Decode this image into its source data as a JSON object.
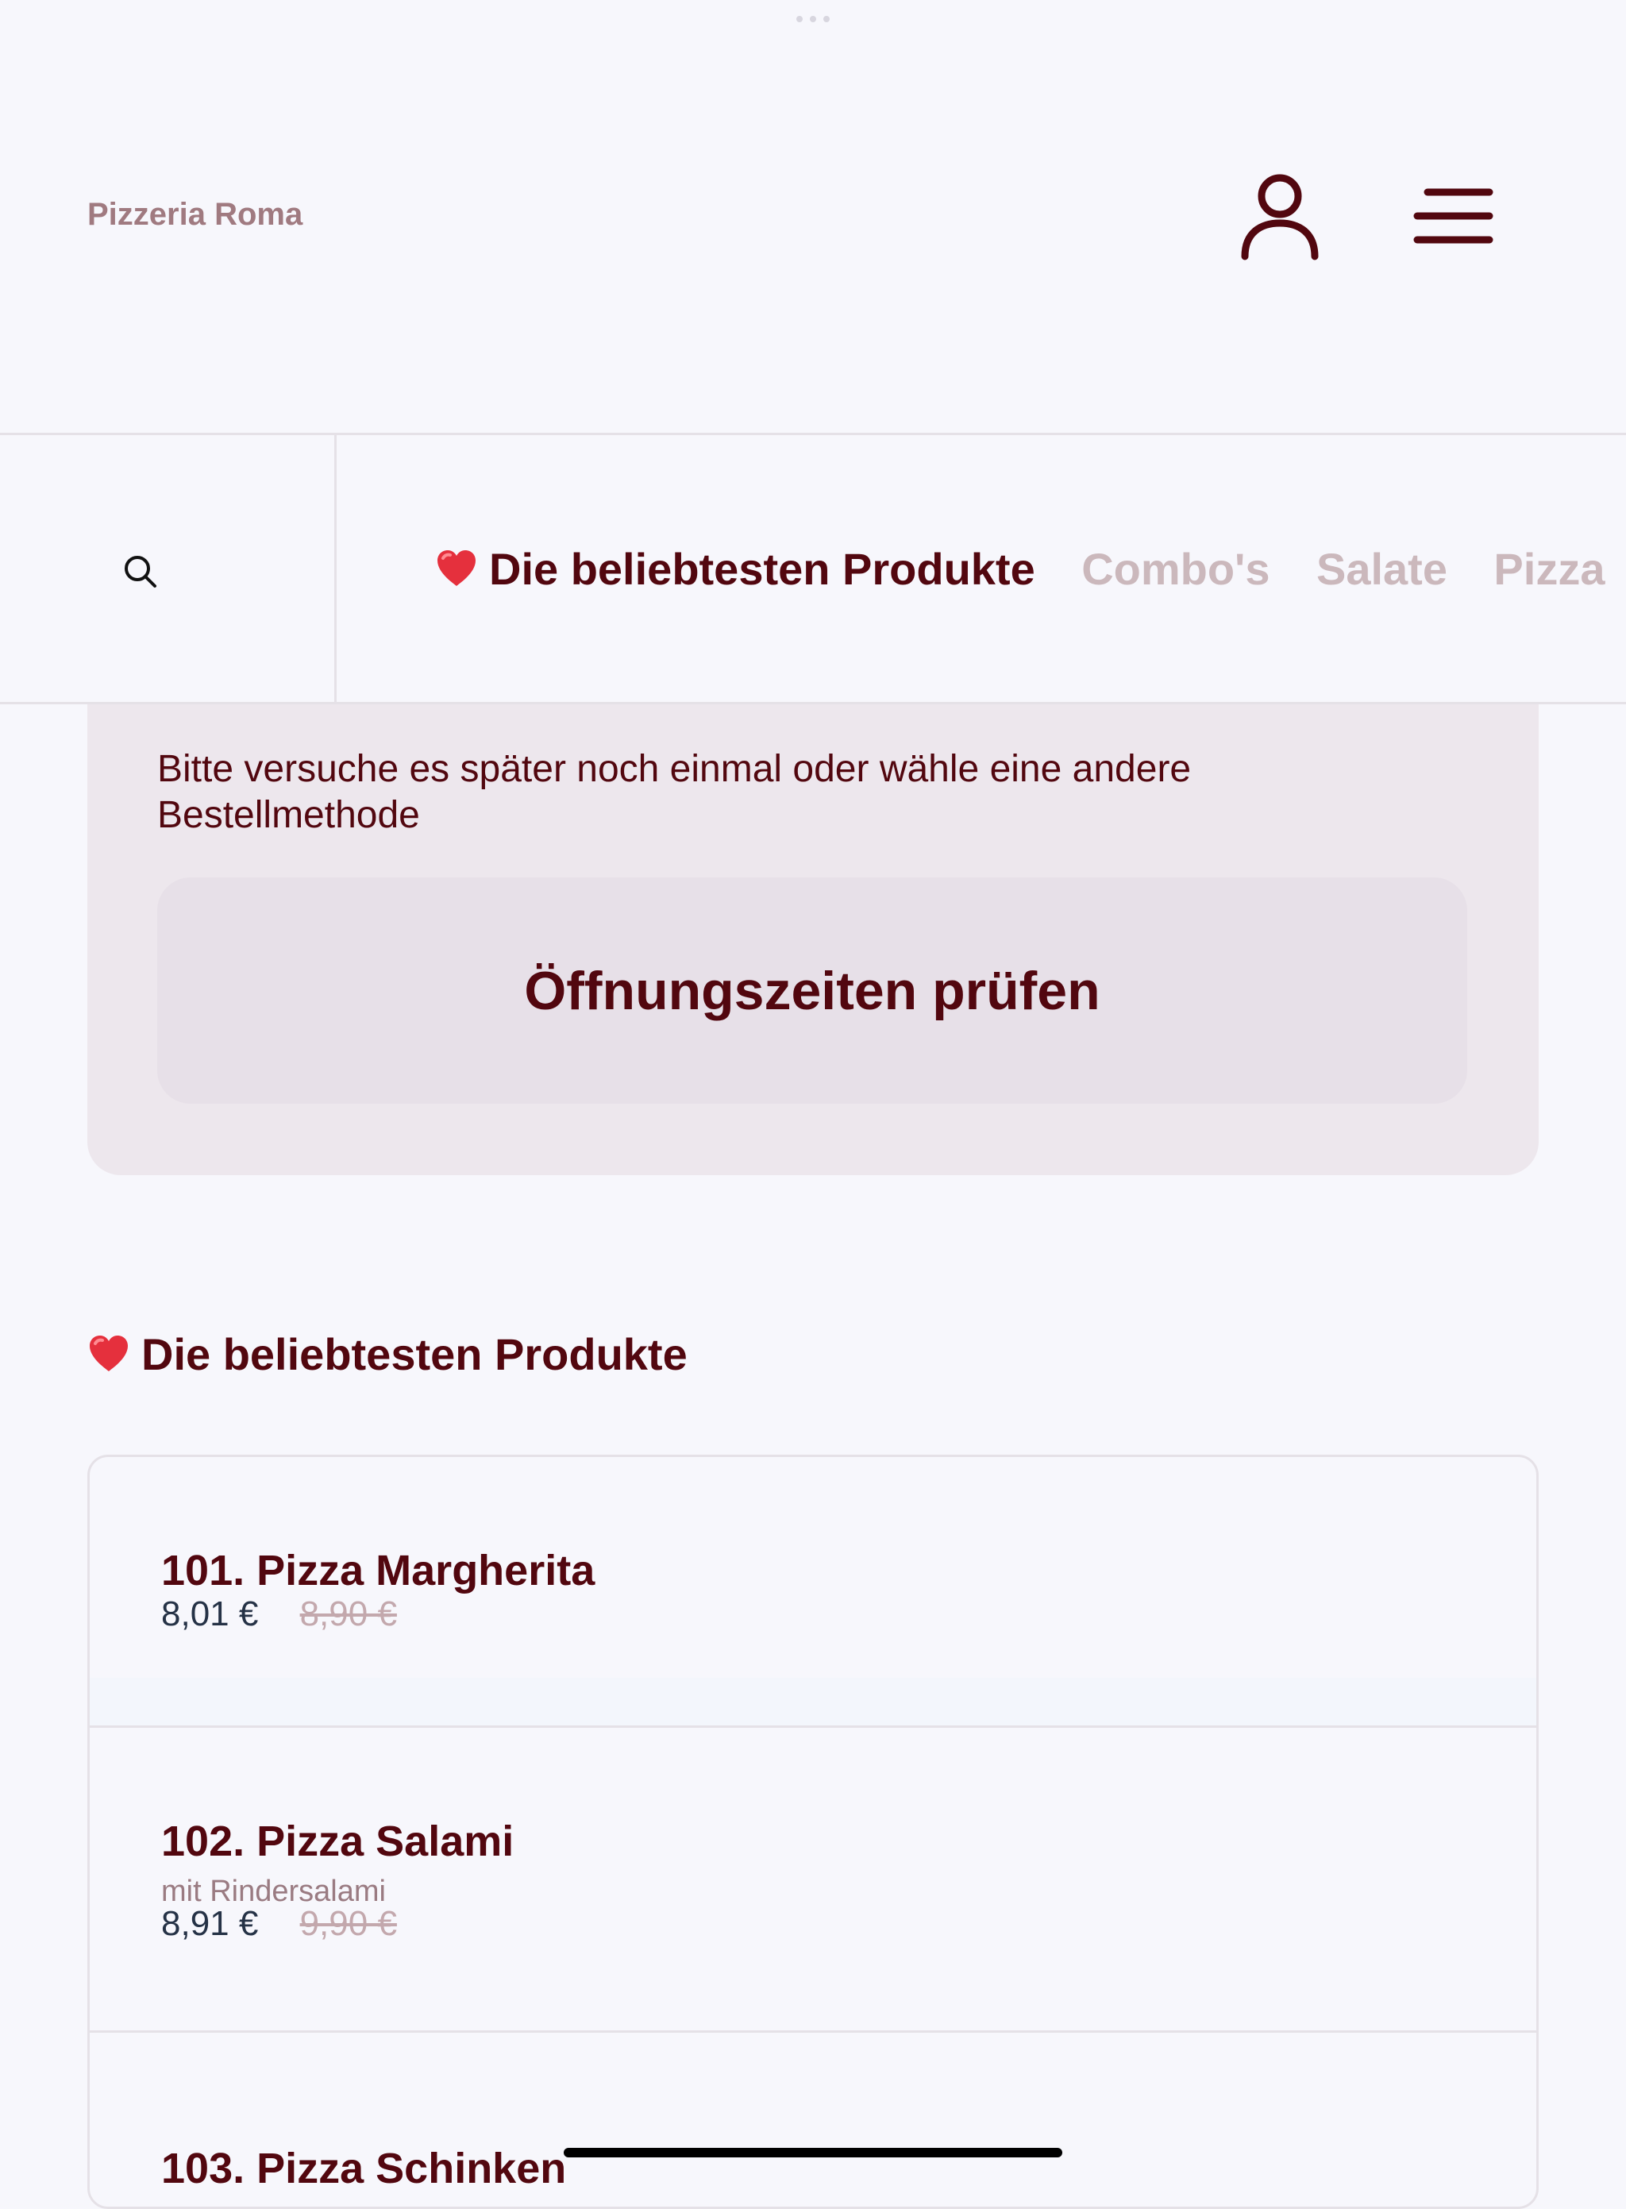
{
  "brand": {
    "name": "Pizzeria Roma"
  },
  "nav": {
    "search_icon": "search-icon",
    "tabs": [
      {
        "label": "Die beliebtesten Produkte",
        "active": true
      },
      {
        "label": "Combo's",
        "active": false
      },
      {
        "label": "Salate",
        "active": false
      },
      {
        "label": "Pizza",
        "active": false
      }
    ]
  },
  "notice": {
    "message": "Bitte versuche es später noch einmal oder wähle eine andere Bestellmethode",
    "button_label": "Öffnungszeiten prüfen"
  },
  "section": {
    "title": "Die beliebtesten Produkte"
  },
  "products": [
    {
      "name": "101. Pizza Margherita",
      "price": "8,01 €",
      "old_price": "8,90 €"
    },
    {
      "name": "102. Pizza Salami",
      "description": "mit Rindersalami",
      "price": "8,91 €",
      "old_price": "9,90 €"
    },
    {
      "name": "103. Pizza Schinken"
    }
  ],
  "icons": {
    "user": "user-icon",
    "menu": "menu-icon",
    "heart": "heart-icon"
  },
  "colors": {
    "primary": "#52070f",
    "background": "#f7f7fc",
    "muted": "#cbb8bc",
    "panel": "#ede7ed",
    "price": "#253246"
  }
}
